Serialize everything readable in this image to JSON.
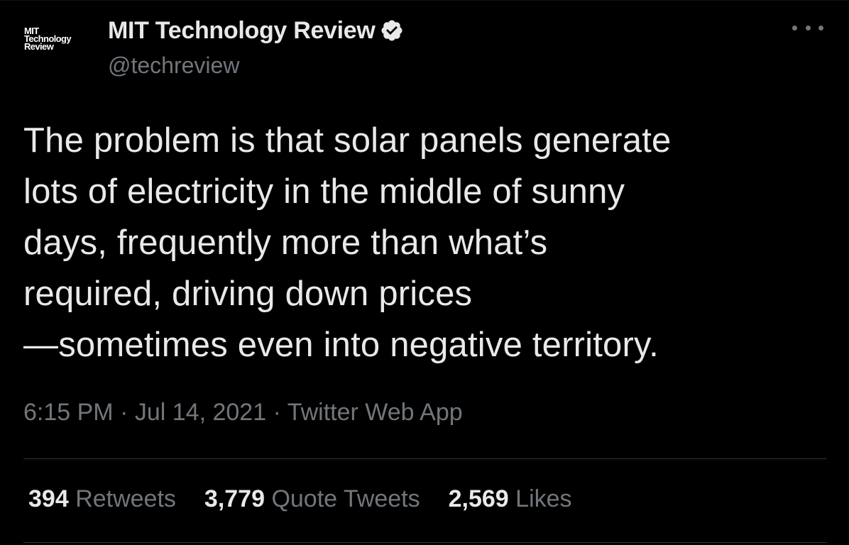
{
  "author": {
    "avatar_lines": [
      "MIT",
      "Technology",
      "Review"
    ],
    "display_name": "MIT Technology Review",
    "handle": "@techreview",
    "verified": true,
    "verified_color": "#e7e9ea"
  },
  "tweet": {
    "text_lines": [
      "The problem is that solar panels generate",
      "lots of electricity in the middle of sunny",
      "days, frequently more than what’s",
      "required, driving down prices",
      "—sometimes even into negative territory."
    ],
    "time": "6:15 PM",
    "date": "Jul 14, 2021",
    "source": "Twitter Web App",
    "separator": "·"
  },
  "stats": [
    {
      "count": "394",
      "label": "Retweets"
    },
    {
      "count": "3,779",
      "label": "Quote Tweets"
    },
    {
      "count": "2,569",
      "label": "Likes"
    }
  ],
  "colors": {
    "background": "#000000",
    "text_primary": "#e7e9ea",
    "text_secondary": "#71767b",
    "divider": "#2f3336"
  },
  "icons": {
    "more": "more-horizontal-icon",
    "verified": "verified-badge-icon"
  }
}
